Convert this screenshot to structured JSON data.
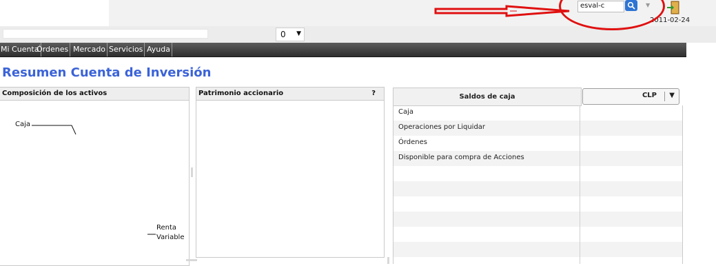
{
  "search": {
    "value": "esval-c"
  },
  "header": {
    "date": "2011-02-24",
    "qty_value": "0"
  },
  "nav": {
    "items": [
      "Mi Cuenta",
      "Órdenes",
      "Mercado",
      "Servicios",
      "Ayuda"
    ]
  },
  "page": {
    "title": "Resumen Cuenta de Inversión"
  },
  "composicion": {
    "title": "Composición de los activos",
    "labels": {
      "caja": "Caja",
      "renta_line1": "Renta",
      "renta_line2": "Variable"
    }
  },
  "patrimonio": {
    "title": "Patrimonio accionario",
    "help": "?"
  },
  "saldos": {
    "title": "Saldos de caja",
    "currency": "CLP",
    "rows": [
      "Caja",
      "Operaciones por Liquidar",
      "Órdenes",
      "Disponible para compra de Acciones"
    ]
  },
  "colors": {
    "title": "#3b63d8",
    "nav_bg": "#3a3a3a",
    "annotation": "#e01010",
    "search_button": "#2e74d4"
  },
  "icons": {
    "search": "magnifier-icon",
    "exit": "exit-door-icon"
  }
}
